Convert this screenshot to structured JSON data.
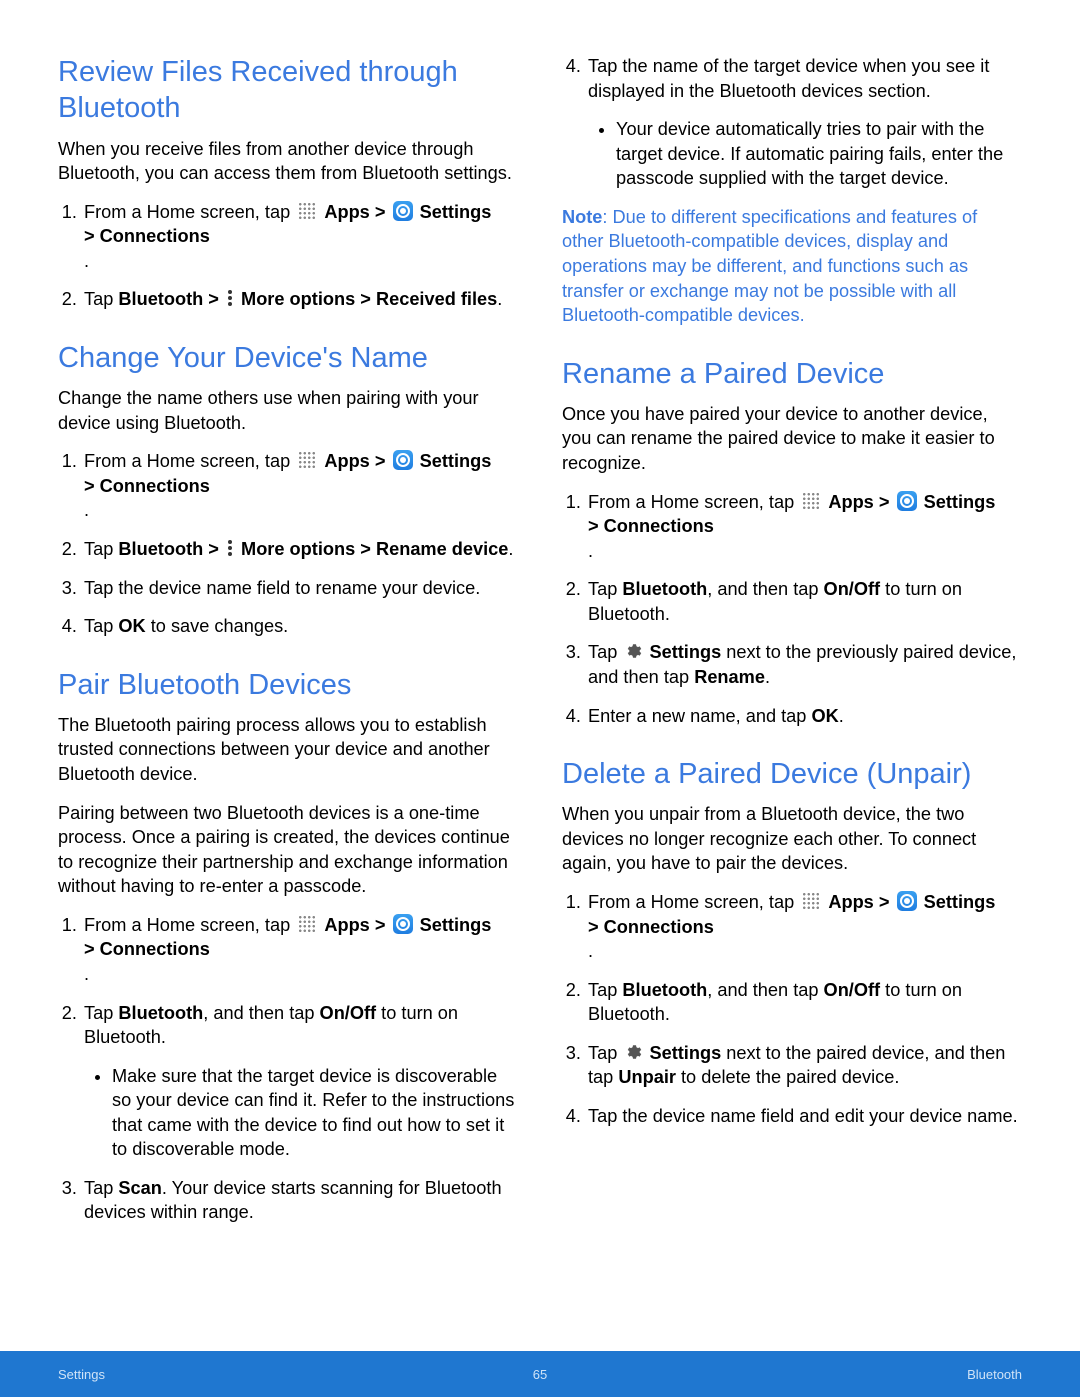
{
  "labels": {
    "apps": "Apps",
    "settings": "Settings",
    "more_options": "More options",
    "gt": ">"
  },
  "footer": {
    "left": "Settings",
    "center": "65",
    "right": "Bluetooth"
  },
  "col1": {
    "s1": {
      "heading": "Review Files Received through Bluetooth",
      "p1": "When you receive files from another device through Bluetooth, you can access them from Bluetooth settings.",
      "li1a": "From a Home screen, tap",
      "li1b": "> Connections",
      "li2a": "Tap ",
      "li2b": "Bluetooth > ",
      "li2c": " > Received files",
      "li2c_plain": "."
    },
    "s2": {
      "heading": "Change Your Device's Name",
      "p1": "Change the name others use when pairing with your device using Bluetooth.",
      "li1a": "From a Home screen, tap",
      "li1b": "> Connections",
      "li2a": "Tap ",
      "li2b": "Bluetooth > ",
      "li2c": " > Rename device",
      "li3": "Tap the device name field to rename your device.",
      "li4a": "Tap ",
      "li4b": "OK",
      "li4c": " to save changes."
    },
    "s3": {
      "heading": "Pair Bluetooth Devices",
      "p1": "The Bluetooth pairing process allows you to establish trusted connections between your device and another Bluetooth device.",
      "p2": "Pairing between two Bluetooth devices is a one-time process. Once a pairing is created, the devices continue to recognize their partnership and exchange information without having to re-enter a passcode.",
      "li1a": "From a Home screen, tap",
      "li1b": "> Connections",
      "li2a": "Tap ",
      "li2b": "Bluetooth",
      "li2c": ", and then tap ",
      "li2d": "On/Off",
      "li2e": " to turn on Bluetooth.",
      "li2_sub": "Make sure that the target device is discoverable so your device can find it. Refer to the instructions that came with the device to find out how to set it to discoverable mode.",
      "li3a": "Tap ",
      "li3b": "Scan",
      "li3c": ". Your device starts scanning for Bluetooth devices within range."
    }
  },
  "col2": {
    "s3cont": {
      "li4": "Tap the name of the target device when you see it displayed in the Bluetooth devices section.",
      "li4_sub": "Your device automatically tries to pair with the target device. If automatic pairing fails, enter the passcode supplied with the target device."
    },
    "note": {
      "label": "Note",
      "text": ": Due to different specifications and features of other Bluetooth-compatible devices, display and operations may be different, and functions such as transfer or exchange may not be possible with all Bluetooth-compatible devices."
    },
    "s4": {
      "heading": "Rename a Paired Device",
      "p1": "Once you have paired your device to another device, you can rename the paired device to make it easier to recognize.",
      "li1a": "From a Home screen, tap",
      "li1b": "> Connections",
      "li2a": "Tap ",
      "li2b": "Bluetooth",
      "li2c": ", and then tap ",
      "li2d": "On/Off",
      "li2e": " to turn on Bluetooth.",
      "li3a": "Tap ",
      "li3b": "Settings",
      "li3c": " next to the previously paired device, and then tap ",
      "li3d": "Rename",
      "li3e": ".",
      "li4a": "Enter a new name, and tap ",
      "li4b": "OK",
      "li4c": "."
    },
    "s5": {
      "heading": "Delete a Paired Device (Unpair)",
      "p1": "When you unpair from a Bluetooth device, the two devices no longer recognize each other. To connect again, you have to pair the devices.",
      "li1a": "From a Home screen, tap",
      "li1b": "> Connections",
      "li2a": "Tap ",
      "li2b": "Bluetooth",
      "li2c": ", and then tap ",
      "li2d": "On/Off",
      "li2e": " to turn on Bluetooth.",
      "li3a": "Tap ",
      "li3b": "Settings",
      "li3c": " next to the paired device, and then tap ",
      "li3d": "Unpair",
      "li3e": " to delete the paired device.",
      "li4": "Tap the device name field and edit your device name."
    }
  }
}
